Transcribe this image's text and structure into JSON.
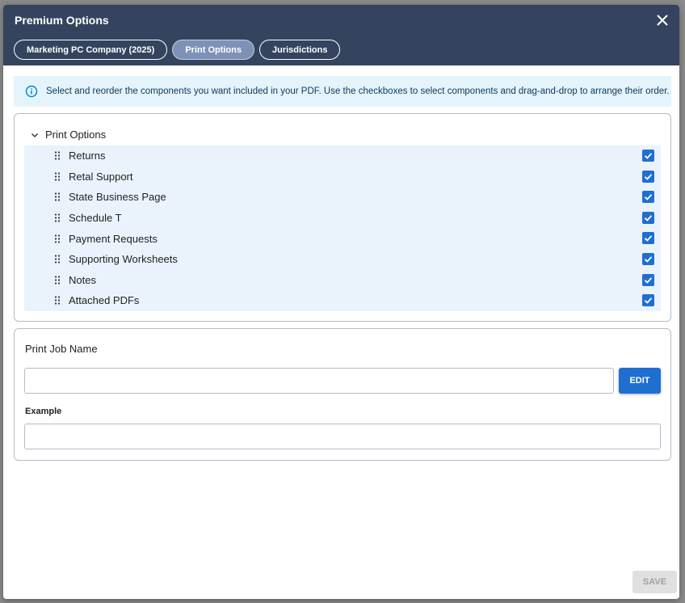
{
  "dialog": {
    "title": "Premium Options",
    "close_icon": "close-icon"
  },
  "tabs": [
    {
      "label": "Marketing PC Company (2025)",
      "active": false
    },
    {
      "label": "Print Options",
      "active": true
    },
    {
      "label": "Jurisdictions",
      "active": false
    }
  ],
  "info": {
    "icon": "info-icon",
    "text": "Select and reorder the components you want included in your PDF. Use the checkboxes to select components and drag-and-drop to arrange their order."
  },
  "print_options": {
    "group_label": "Print Options",
    "expanded": true,
    "items": [
      {
        "label": "Returns",
        "checked": true
      },
      {
        "label": "Retal Support",
        "checked": true
      },
      {
        "label": "State Business Page",
        "checked": true
      },
      {
        "label": "Schedule T",
        "checked": true
      },
      {
        "label": "Payment Requests",
        "checked": true
      },
      {
        "label": "Supporting Worksheets",
        "checked": true
      },
      {
        "label": "Notes",
        "checked": true
      },
      {
        "label": "Attached PDFs",
        "checked": true
      }
    ]
  },
  "print_job": {
    "label": "Print Job Name",
    "value": "",
    "edit_label": "EDIT",
    "example_label": "Example",
    "example_value": ""
  },
  "footer": {
    "save_label": "SAVE",
    "save_disabled": true
  },
  "colors": {
    "header_bg": "#34445e",
    "active_tab_bg": "#7e92b7",
    "accent": "#1f6fd1",
    "info_bg": "#e5f4fb",
    "list_bg": "#eaf3fc"
  }
}
